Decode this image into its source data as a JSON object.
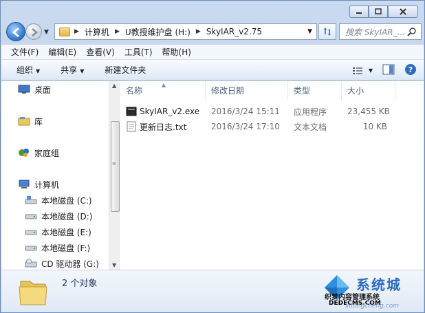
{
  "address": {
    "crumbs": [
      "计算机",
      "U教授维护盘 (H:)",
      "SkyIAR_v2.75"
    ]
  },
  "search": {
    "placeholder": "搜索 SkyIAR_..."
  },
  "menu": [
    "文件(F)",
    "编辑(E)",
    "查看(V)",
    "工具(T)",
    "帮助(H)"
  ],
  "toolbar": {
    "organize": "组织",
    "share": "共享",
    "new_folder": "新建文件夹"
  },
  "nav_pane": {
    "desktop": "桌面",
    "library": "库",
    "homegroup": "家庭组",
    "computer": "计算机",
    "drives": [
      "本地磁盘 (C:)",
      "本地磁盘 (D:)",
      "本地磁盘 (E:)",
      "本地磁盘 (F:)",
      "CD 驱动器 (G:)"
    ]
  },
  "columns": [
    "名称",
    "修改日期",
    "类型",
    "大小"
  ],
  "files": [
    {
      "name": "SkyIAR_v2.exe",
      "date": "2016/3/24 15:11",
      "type": "应用程序",
      "size": "23,455 KB",
      "icon": "exe-icon"
    },
    {
      "name": "更新日志.txt",
      "date": "2016/3/24 17:10",
      "type": "文本文档",
      "size": "10 KB",
      "icon": "txt-icon"
    }
  ],
  "details": {
    "count": "2 个对象"
  },
  "watermark": {
    "line1": "系统城",
    "line2": "织梦内容管理系统",
    "line3": "DEDECMS.COM",
    "line4": "xitongcheng.com"
  },
  "colors": {
    "accent": "#2c73c9",
    "window_frame": "#b9cde8"
  }
}
